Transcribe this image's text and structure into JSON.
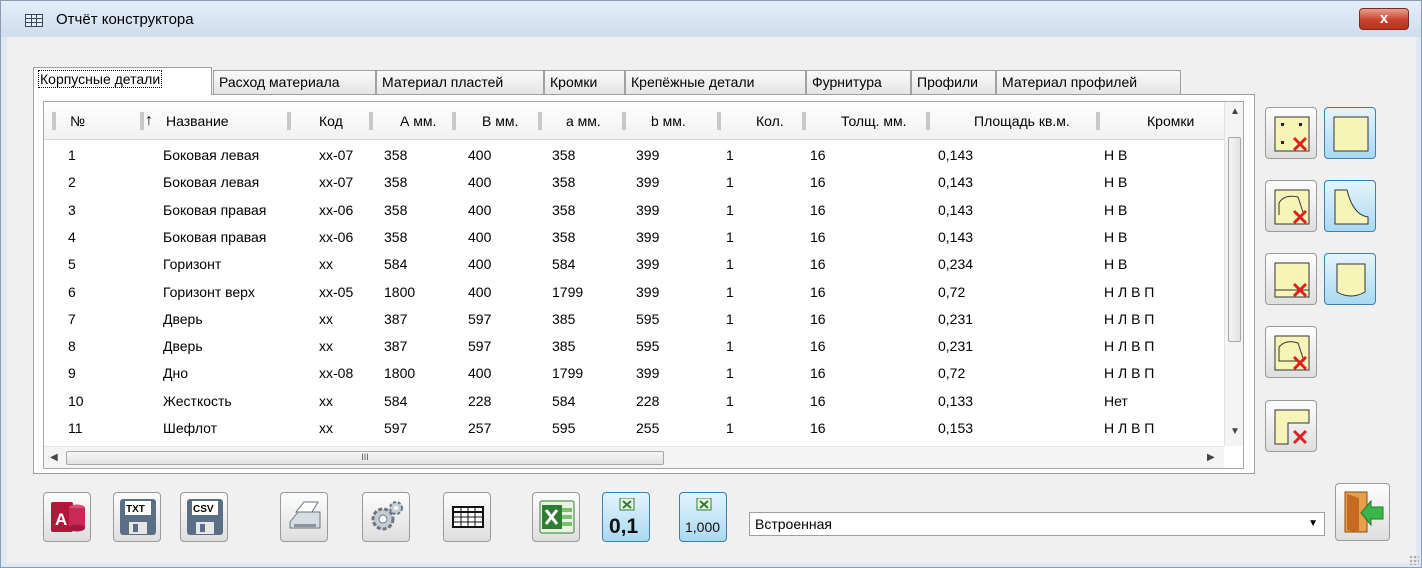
{
  "window": {
    "title": "Отчёт конструктора",
    "close_label": "x"
  },
  "tabs": [
    {
      "label": "Корпусные детали",
      "active": true
    },
    {
      "label": "Расход материала"
    },
    {
      "label": "Материал пластей"
    },
    {
      "label": "Кромки"
    },
    {
      "label": "Крепёжные детали"
    },
    {
      "label": "Фурнитура"
    },
    {
      "label": "Профили"
    },
    {
      "label": "Материал профилей"
    }
  ],
  "grid": {
    "columns": [
      "№",
      "Название",
      "Код",
      "А мм.",
      "В мм.",
      "а мм.",
      "b мм.",
      "Кол.",
      "Толщ. мм.",
      "Площадь кв.м.",
      "Кромки"
    ],
    "sort_indicator": "↑",
    "rows": [
      [
        "1",
        "Боковая левая",
        "xx-07",
        "358",
        "400",
        "358",
        "399",
        "1",
        "16",
        "0,143",
        "Н В"
      ],
      [
        "2",
        "Боковая левая",
        "xx-07",
        "358",
        "400",
        "358",
        "399",
        "1",
        "16",
        "0,143",
        "Н В"
      ],
      [
        "3",
        "Боковая правая",
        "xx-06",
        "358",
        "400",
        "358",
        "399",
        "1",
        "16",
        "0,143",
        "Н В"
      ],
      [
        "4",
        "Боковая правая",
        "xx-06",
        "358",
        "400",
        "358",
        "399",
        "1",
        "16",
        "0,143",
        "Н В"
      ],
      [
        "5",
        "Горизонт",
        "xx",
        "584",
        "400",
        "584",
        "399",
        "1",
        "16",
        "0,234",
        "Н В"
      ],
      [
        "6",
        "Горизонт верх",
        "xx-05",
        "1800",
        "400",
        "1799",
        "399",
        "1",
        "16",
        "0,72",
        "Н Л В П"
      ],
      [
        "7",
        "Дверь",
        "xx",
        "387",
        "597",
        "385",
        "595",
        "1",
        "16",
        "0,231",
        "Н Л В П"
      ],
      [
        "8",
        "Дверь",
        "xx",
        "387",
        "597",
        "385",
        "595",
        "1",
        "16",
        "0,231",
        "Н Л В П"
      ],
      [
        "9",
        "Дно",
        "xx-08",
        "1800",
        "400",
        "1799",
        "399",
        "1",
        "16",
        "0,72",
        "Н Л В П"
      ],
      [
        "10",
        "Жесткость",
        "xx",
        "584",
        "228",
        "584",
        "228",
        "1",
        "16",
        "0,133",
        "Нет"
      ],
      [
        "11",
        "Шефлот",
        "xx",
        "597",
        "257",
        "595",
        "255",
        "1",
        "16",
        "0,153",
        "Н Л В П"
      ]
    ],
    "hscroll_grip": "III"
  },
  "side_tools": [
    {
      "icon": "panel-holes-delete-icon"
    },
    {
      "icon": "panel-square-icon"
    },
    {
      "icon": "panel-arc-delete-icon"
    },
    {
      "icon": "panel-curve-icon"
    },
    {
      "icon": "panel-edge-delete-icon"
    },
    {
      "icon": "panel-cylinder-icon"
    },
    {
      "icon": "panel-round-delete-icon"
    },
    {
      "icon": "panel-notch-delete-icon"
    }
  ],
  "bottom": {
    "txt_label": "TXT",
    "csv_label": "CSV",
    "excel_format_1": "0,1",
    "excel_format_2": "1,000",
    "template_value": "Встроенная",
    "access_label": "A"
  }
}
